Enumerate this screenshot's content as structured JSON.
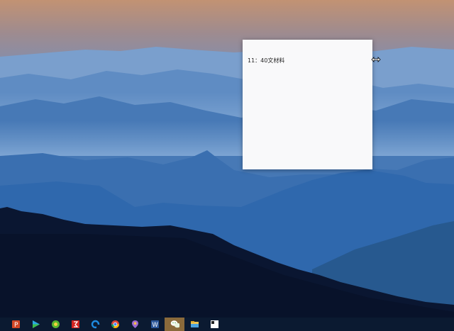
{
  "note": {
    "text": "11：40文材料"
  },
  "taskbar": {
    "items": [
      {
        "name": "powerpoint-icon",
        "active": false
      },
      {
        "name": "media-player-icon",
        "active": false
      },
      {
        "name": "green-app-icon",
        "active": false
      },
      {
        "name": "red-app-icon",
        "active": false
      },
      {
        "name": "sync-app-icon",
        "active": false
      },
      {
        "name": "chrome-icon",
        "active": false
      },
      {
        "name": "pin-app-icon",
        "active": false
      },
      {
        "name": "word-icon",
        "active": false
      },
      {
        "name": "wechat-icon",
        "active": true
      },
      {
        "name": "file-explorer-icon",
        "active": false
      },
      {
        "name": "sticky-notes-icon",
        "active": false
      }
    ]
  },
  "colors": {
    "sky_top": "#b88f72",
    "sky_mid": "#6e8fbf",
    "mountain_far": "#4f7fb9",
    "mountain_mid": "#2f68ad",
    "forest": "#0a1631",
    "taskbar": "#0b1a31",
    "active_item": "#8a6a3b"
  }
}
